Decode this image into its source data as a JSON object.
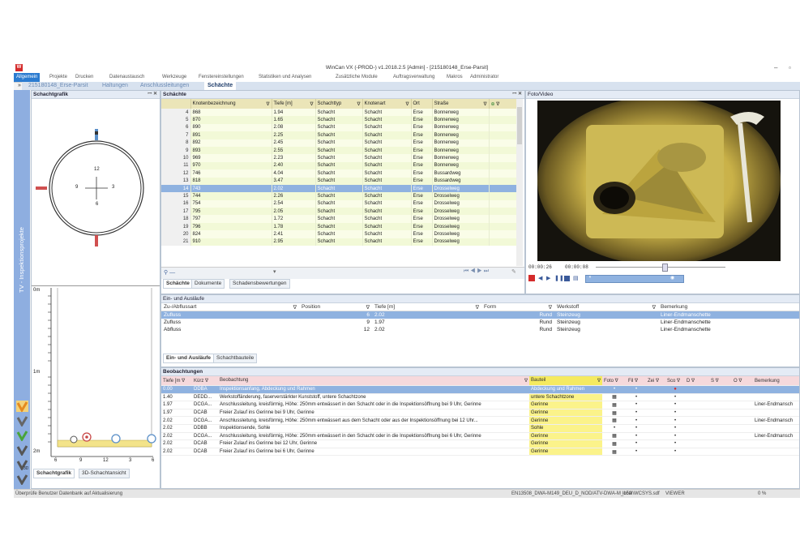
{
  "window": {
    "title": "WinCan VX (-PROD-) v1.2018.2.5 [Admin] - [215180148_Erse-Parsit]"
  },
  "ribbon": {
    "tabs": [
      "Allgemein",
      "Projekte",
      "Drucken",
      "Datenaustausch",
      "Werkzeuge",
      "Fenstereinstellungen",
      "Statistiken und Analysen",
      "Zusätzliche Module",
      "Auftragsverwaltung",
      "Makros",
      "Administrator"
    ],
    "active": "Allgemein"
  },
  "doc_tabs": [
    "215180148_Erse-Parsit",
    "Haltungen",
    "Anschlussleitungen",
    "Schächte"
  ],
  "sidebar": {
    "label": "TV - Inspektionsprojekte"
  },
  "schachtgrafik": {
    "title": "Schachtgrafik",
    "clock": {
      "top": "12",
      "left": "9",
      "right": "3",
      "bottom": "6"
    },
    "depth_labels": [
      "0m",
      "1m",
      "2m"
    ],
    "x_labels": [
      "6",
      "9",
      "12",
      "3",
      "6"
    ],
    "tabs": [
      "Schachtgrafik",
      "3D-Schachtansicht"
    ]
  },
  "schaechte": {
    "title": "Schächte",
    "columns": [
      "Knotenbezeichnung",
      "Tiefe [m]",
      "Schachttyp",
      "Knotenart",
      "Ort",
      "Straße"
    ],
    "rows": [
      [
        "4",
        "868",
        "1.94",
        "Schacht",
        "Schacht",
        "Erse",
        "Bonnerweg"
      ],
      [
        "5",
        "870",
        "1.65",
        "Schacht",
        "Schacht",
        "Erse",
        "Bonnerweg"
      ],
      [
        "6",
        "890",
        "2.08",
        "Schacht",
        "Schacht",
        "Erse",
        "Bonnerweg"
      ],
      [
        "7",
        "891",
        "2.25",
        "Schacht",
        "Schacht",
        "Erse",
        "Bonnerweg"
      ],
      [
        "8",
        "892",
        "2.45",
        "Schacht",
        "Schacht",
        "Erse",
        "Bonnerweg"
      ],
      [
        "9",
        "893",
        "2.55",
        "Schacht",
        "Schacht",
        "Erse",
        "Bonnerweg"
      ],
      [
        "10",
        "969",
        "2.23",
        "Schacht",
        "Schacht",
        "Erse",
        "Bonnerweg"
      ],
      [
        "11",
        "970",
        "2.40",
        "Schacht",
        "Schacht",
        "Erse",
        "Bonnerweg"
      ],
      [
        "12",
        "746",
        "4.04",
        "Schacht",
        "Schacht",
        "Erse",
        "Bussardweg"
      ],
      [
        "13",
        "818",
        "3.47",
        "Schacht",
        "Schacht",
        "Erse",
        "Bussardweg"
      ],
      [
        "14",
        "743",
        "2.02",
        "Schacht",
        "Schacht",
        "Erse",
        "Drosselweg"
      ],
      [
        "15",
        "744",
        "2.26",
        "Schacht",
        "Schacht",
        "Erse",
        "Drosselweg"
      ],
      [
        "16",
        "754",
        "2.54",
        "Schacht",
        "Schacht",
        "Erse",
        "Drosselweg"
      ],
      [
        "17",
        "795",
        "2.05",
        "Schacht",
        "Schacht",
        "Erse",
        "Drosselweg"
      ],
      [
        "18",
        "797",
        "1.72",
        "Schacht",
        "Schacht",
        "Erse",
        "Drosselweg"
      ],
      [
        "19",
        "796",
        "1.78",
        "Schacht",
        "Schacht",
        "Erse",
        "Drosselweg"
      ],
      [
        "20",
        "824",
        "2.41",
        "Schacht",
        "Schacht",
        "Erse",
        "Drosselweg"
      ],
      [
        "21",
        "910",
        "2.95",
        "Schacht",
        "Schacht",
        "Erse",
        "Drosselweg"
      ]
    ],
    "selected_row": 10,
    "tabs": [
      "Schächte",
      "Dokumente",
      "Schadensbewertungen"
    ]
  },
  "video": {
    "title": "Foto/Video",
    "time_current": "00:00:26",
    "time_total": "00:00:08"
  },
  "einauslaeufe": {
    "title": "Ein- und Ausläufe",
    "columns": [
      "Zu-/Abflussart",
      "Position",
      "Tiefe [m]",
      "Form",
      "Werkstoff",
      "Bemerkung"
    ],
    "rows": [
      [
        "Zufluss",
        "6",
        "2.02",
        "Rund",
        "Steinzeug",
        "Liner-Endmanschette"
      ],
      [
        "Zufluss",
        "9",
        "1.97",
        "Rund",
        "Steinzeug",
        "Liner-Endmanschette"
      ],
      [
        "Abfluss",
        "12",
        "2.02",
        "Rund",
        "Steinzeug",
        "Liner-Endmanschette"
      ]
    ],
    "tabs": [
      "Ein- und Ausläufe",
      "Schachtbauteile"
    ]
  },
  "beobachtungen": {
    "title": "Beobachtungen",
    "columns": [
      "Tiefe [m",
      "Kürz",
      "Beobachtung",
      "Bauteil",
      "Foto",
      "Fil",
      "Zei",
      "Sco",
      "D",
      "S",
      "O",
      "Bemerkung"
    ],
    "rows": [
      [
        "0.00",
        "DDBA",
        "Inspektionsanfang, Abdeckung und Rahmen",
        "Abdeckung und Rahmen",
        ""
      ],
      [
        "1.40",
        "DEDD...",
        "Werkstoffänderung, faserverstärkter Kunststoff, untere Schachtzone",
        "untere Schachtzone",
        ""
      ],
      [
        "1.97",
        "DCGA...",
        "Anschlussleitung, kreisförmig, Höhe: 250mm entwässert in den Schacht oder in die Inspektionsöffnung bei 9 Uhr, Gerinne",
        "Gerinne",
        "Liner-Endmansch"
      ],
      [
        "1.97",
        "DCAB",
        "Freier Zulauf ins Gerinne bei 9 Uhr, Gerinne",
        "Gerinne",
        ""
      ],
      [
        "2.02",
        "DCGA...",
        "Anschlussleitung, kreisförmig, Höhe: 250mm entwässert aus dem Schacht oder aus der Inspektionsöffnung bei 12 Uhr...",
        "Gerinne",
        "Liner-Endmansch"
      ],
      [
        "2.02",
        "DDBB",
        "Inspektionsende, Sohle",
        "Sohle",
        ""
      ],
      [
        "2.02",
        "DCGA...",
        "Anschlussleitung, kreisförmig, Höhe: 250mm entwässert in den Schacht oder in die Inspektionsöffnung bei 6 Uhr, Gerinne",
        "Gerinne",
        "Liner-Endmansch"
      ],
      [
        "2.02",
        "DCAB",
        "Freier Zulauf ins Gerinne bei 12 Uhr, Gerinne",
        "Gerinne",
        ""
      ],
      [
        "2.02",
        "DCAB",
        "Freier Zulauf ins Gerinne bei 6 Uhr, Gerinne",
        "Gerinne",
        ""
      ]
    ]
  },
  "status": {
    "left": "Überprüfe Benutzer Datenbank auf Aktualisierung",
    "standard": "EN13508_DWA-M149_DEU_D_NOD/ATV-DWA-M_150",
    "db": "local\\WCSYS.sdf",
    "viewer": "VIEWER",
    "percent": "0 %"
  }
}
